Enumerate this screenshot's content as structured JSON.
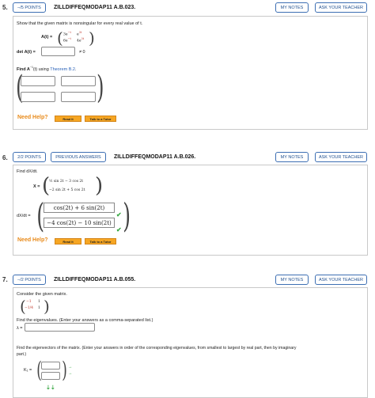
{
  "questions": [
    {
      "number": "5.",
      "points": "–/5 POINTS",
      "id": "ZILLDIFFEQMODAP11 A.B.023.",
      "my_notes": "MY NOTES",
      "ask_teacher": "ASK YOUR TEACHER",
      "prompt": "Show that the given matrix is nonsingular for every real value of t.",
      "matrix_label": "A(t) =",
      "matrix": [
        [
          "3e",
          "e"
        ],
        [
          "6e",
          "4e"
        ]
      ],
      "exps": [
        [
          "−t",
          "3t"
        ],
        [
          "−t",
          "3t"
        ]
      ],
      "det_label": "det A(t) =",
      "det_suffix": "≠ 0",
      "find_prefix": "Find A",
      "find_sup": "−1",
      "find_mid": "(t) using ",
      "find_link": "Theorem B.2",
      "find_end": ".",
      "need_help": "Need Help?",
      "read_it": "Read It",
      "talk_tutor": "Talk to a Tutor"
    },
    {
      "number": "6.",
      "points": "2/2 POINTS",
      "previous": "PREVIOUS ANSWERS",
      "id": "ZILLDIFFEQMODAP11 A.B.026.",
      "my_notes": "MY NOTES",
      "ask_teacher": "ASK YOUR TEACHER",
      "prompt": "Find dX/dt.",
      "x_label": "X =",
      "x_row1": "½ sin 2t − 3 cos 2t",
      "x_row2": "−2 sin 2t + 5 cos 2t",
      "dx_label": "dX/dt =",
      "ans1": "cos(2t) + 6 sin(2t)",
      "ans2": "−4 cos(2t) − 10 sin(2t)",
      "need_help": "Need Help?",
      "read_it": "Read It",
      "talk_tutor": "Talk to a Tutor"
    },
    {
      "number": "7.",
      "points": "–/2 POINTS",
      "id": "ZILLDIFFEQMODAP11 A.B.055.",
      "my_notes": "MY NOTES",
      "ask_teacher": "ASK YOUR TEACHER",
      "prompt": "Consider the given matrix.",
      "matrix": [
        [
          "−1",
          "1"
        ],
        [
          "−1/4",
          "1"
        ]
      ],
      "eig_prompt": "Find the eigenvalues. (Enter your answers as a comma-separated list.)",
      "lambda_label": "λ =",
      "vec_prompt_1": "Find the eigenvectors of the matrix. (Enter your answers in order of the corresponding eigenvalues, from smallest to largest by real part, then by imaginary",
      "vec_prompt_2": "part.)",
      "k1_label": "K₁ ="
    }
  ],
  "colors": {
    "accent": "#3d6fb3",
    "orange": "#f6a623",
    "check": "#3aa845"
  }
}
